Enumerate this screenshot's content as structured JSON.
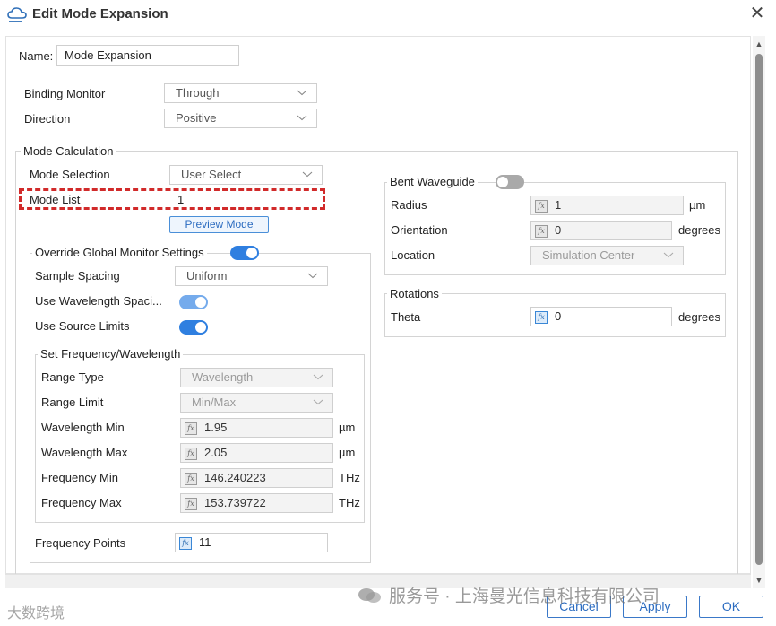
{
  "window": {
    "title": "Edit Mode Expansion"
  },
  "name": {
    "label": "Name:",
    "value": "Mode Expansion"
  },
  "binding_monitor": {
    "label": "Binding Monitor",
    "value": "Through"
  },
  "direction": {
    "label": "Direction",
    "value": "Positive"
  },
  "mode_calculation": {
    "title": "Mode Calculation",
    "mode_selection": {
      "label": "Mode Selection",
      "value": "User Select"
    },
    "mode_list": {
      "label": "Mode List",
      "value": "1"
    },
    "preview_button": "Preview Mode"
  },
  "override": {
    "title": "Override Global Monitor Settings",
    "toggle_on": true,
    "sample_spacing": {
      "label": "Sample Spacing",
      "value": "Uniform"
    },
    "use_wavelength_spacing": {
      "label": "Use Wavelength Spaci...",
      "on": true
    },
    "use_source_limits": {
      "label": "Use Source Limits",
      "on": true
    },
    "set_freq": {
      "title": "Set Frequency/Wavelength",
      "range_type": {
        "label": "Range Type",
        "value": "Wavelength"
      },
      "range_limit": {
        "label": "Range Limit",
        "value": "Min/Max"
      },
      "wavelength_min": {
        "label": "Wavelength Min",
        "value": "1.95",
        "unit": "µm"
      },
      "wavelength_max": {
        "label": "Wavelength Max",
        "value": "2.05",
        "unit": "µm"
      },
      "frequency_min": {
        "label": "Frequency Min",
        "value": "146.240223",
        "unit": "THz"
      },
      "frequency_max": {
        "label": "Frequency Max",
        "value": "153.739722",
        "unit": "THz"
      }
    },
    "frequency_points": {
      "label": "Frequency Points",
      "value": "11"
    }
  },
  "bent_waveguide": {
    "title": "Bent Waveguide",
    "toggle_on": false,
    "radius": {
      "label": "Radius",
      "value": "1",
      "unit": "µm"
    },
    "orientation": {
      "label": "Orientation",
      "value": "0",
      "unit": "degrees"
    },
    "location": {
      "label": "Location",
      "value": "Simulation Center"
    }
  },
  "rotations": {
    "title": "Rotations",
    "theta": {
      "label": "Theta",
      "value": "0",
      "unit": "degrees"
    }
  },
  "footer": {
    "cancel": "Cancel",
    "apply": "Apply",
    "ok": "OK"
  },
  "watermark": {
    "text": "服务号 · 上海曼光信息科技有限公司",
    "corner": "大数跨境"
  },
  "icon_names": {
    "title": "cloud-edit-icon",
    "close": "close-icon",
    "chevron": "chevron-down-icon",
    "fx": "fx-icon",
    "wechat": "wechat-icon"
  },
  "colors": {
    "accent": "#2f7fe0",
    "highlight_border": "#d12a2a",
    "button_text": "#2c6cc0"
  }
}
